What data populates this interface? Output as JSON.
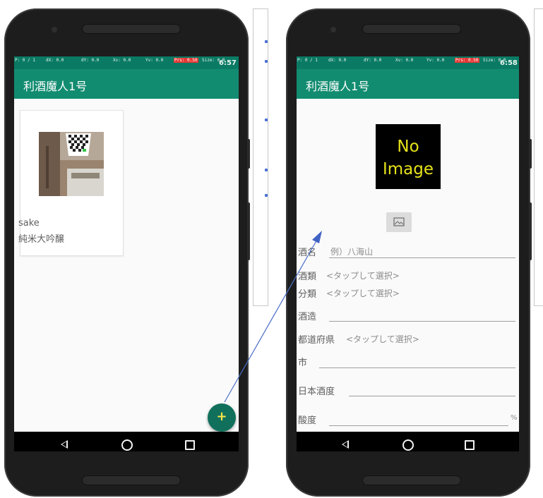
{
  "left_phone": {
    "status_bar": {
      "p": "P: 0 / 1",
      "dx": "dX: 0.0",
      "dy": "dY: 0.0",
      "xv": "Xv: 0.0",
      "yv": "Yv: 0.0",
      "prs": "Prs: 0.50",
      "size": "Size: 0.0",
      "clock": "6:57"
    },
    "app_title": "利酒魔人1号",
    "card": {
      "name": "sake",
      "type": "純米大吟醸"
    },
    "fab_label": "+",
    "nav": {
      "back_icon": "triangle-back",
      "home_icon": "circle-home",
      "recent_icon": "square-recent"
    }
  },
  "right_phone": {
    "status_bar": {
      "p": "P: 0 / 1",
      "dx": "dX: 0.0",
      "dy": "dY: 0.0",
      "xv": "Xv: 0.0",
      "yv": "Yv: 0.0",
      "prs": "Prs: 0.50",
      "size": "Size: 0.0",
      "clock": "6:58"
    },
    "app_title": "利酒魔人1号",
    "no_image_line1": "No",
    "no_image_line2": "Image",
    "image_button_icon": "picture-icon",
    "form": {
      "sake_name_label": "酒名",
      "sake_name_placeholder": "例）八海山",
      "sake_type_label": "酒類",
      "sake_type_value": "<タップして選択>",
      "category_label": "分類",
      "category_value": "<タップして選択>",
      "brewery_label": "酒造",
      "prefecture_label": "都道府県",
      "prefecture_value": "<タップして選択>",
      "city_label": "市",
      "smv_label": "日本酒度",
      "acidity_label": "酸度",
      "acidity_unit": "%"
    }
  },
  "colors": {
    "app_bar": "#128c70",
    "status_bar": "#0a7a64",
    "fab": "#10705c",
    "arrow": "#4a6fc9"
  }
}
